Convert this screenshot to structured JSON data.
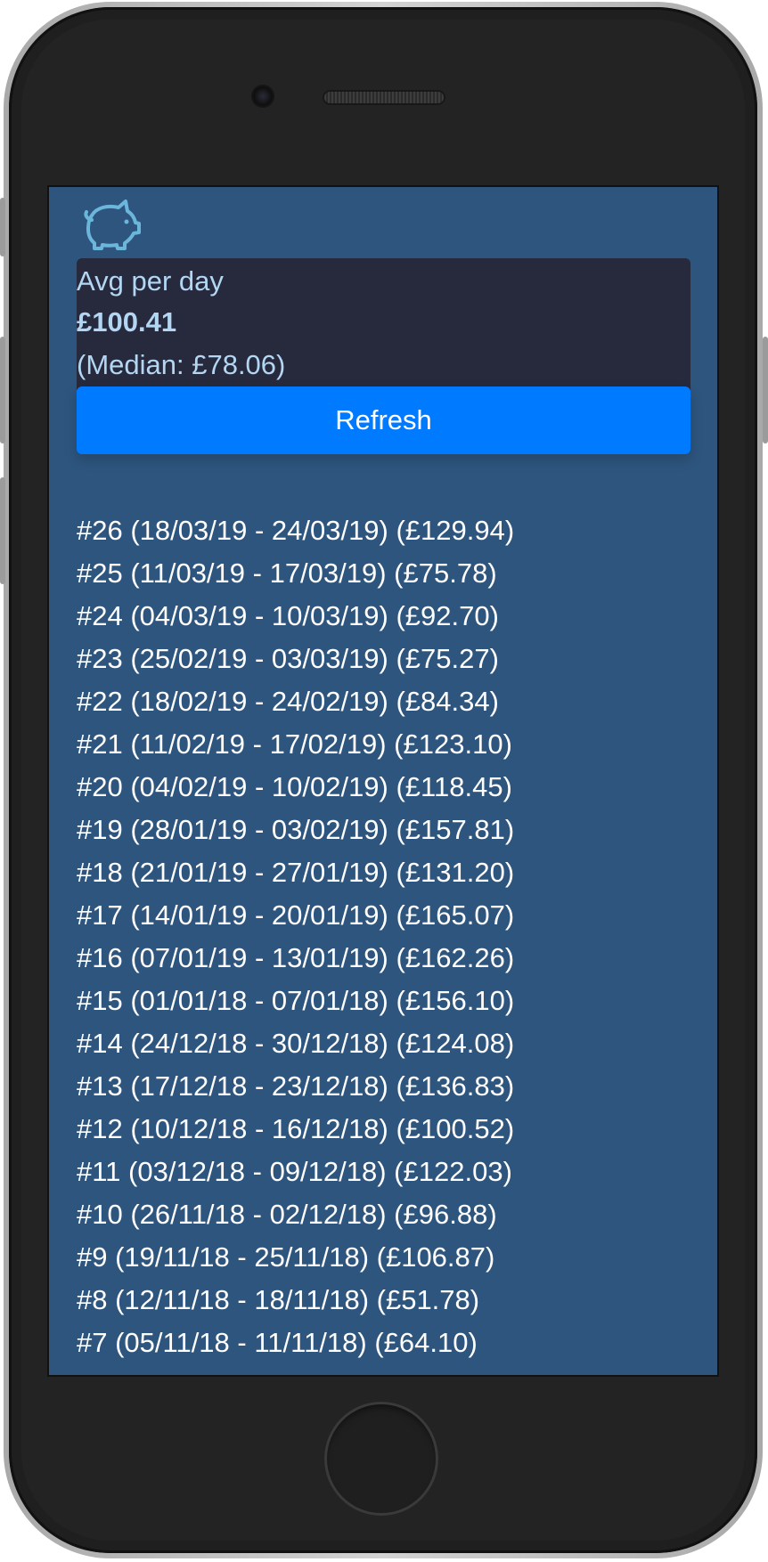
{
  "stats": {
    "avg_label": "Avg per day",
    "avg_value": "£100.41",
    "median_text": "(Median: £78.06)"
  },
  "actions": {
    "refresh_label": "Refresh"
  },
  "icons": {
    "app_icon": "piggy-bank-icon"
  },
  "colors": {
    "screen_bg": "#2d557e",
    "card_bg": "#27293d",
    "accent": "#007aff",
    "stat_text": "#b3d7f3",
    "list_text": "#ffffff"
  },
  "weeks": [
    {
      "text": "#26 (18/03/19 - 24/03/19) (£129.94)"
    },
    {
      "text": "#25 (11/03/19 - 17/03/19) (£75.78)"
    },
    {
      "text": "#24 (04/03/19 - 10/03/19) (£92.70)"
    },
    {
      "text": "#23 (25/02/19 - 03/03/19) (£75.27)"
    },
    {
      "text": "#22 (18/02/19 - 24/02/19) (£84.34)"
    },
    {
      "text": "#21 (11/02/19 - 17/02/19) (£123.10)"
    },
    {
      "text": "#20 (04/02/19 - 10/02/19) (£118.45)"
    },
    {
      "text": "#19 (28/01/19 - 03/02/19) (£157.81)"
    },
    {
      "text": "#18 (21/01/19 - 27/01/19) (£131.20)"
    },
    {
      "text": "#17 (14/01/19 - 20/01/19) (£165.07)"
    },
    {
      "text": "#16 (07/01/19 - 13/01/19) (£162.26)"
    },
    {
      "text": "#15 (01/01/18 - 07/01/18) (£156.10)"
    },
    {
      "text": "#14 (24/12/18 - 30/12/18) (£124.08)"
    },
    {
      "text": "#13 (17/12/18 - 23/12/18) (£136.83)"
    },
    {
      "text": "#12 (10/12/18 - 16/12/18) (£100.52)"
    },
    {
      "text": "#11 (03/12/18 - 09/12/18) (£122.03)"
    },
    {
      "text": "#10 (26/11/18 - 02/12/18) (£96.88)"
    },
    {
      "text": "#9 (19/11/18 - 25/11/18) (£106.87)"
    },
    {
      "text": "#8 (12/11/18 - 18/11/18) (£51.78)"
    },
    {
      "text": "#7 (05/11/18 - 11/11/18) (£64.10)"
    }
  ]
}
